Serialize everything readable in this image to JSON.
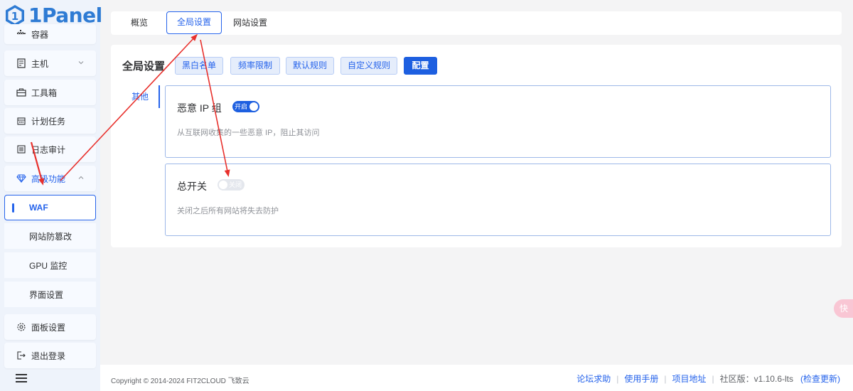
{
  "app": {
    "logo_text": "1Panel"
  },
  "sidebar": {
    "items": [
      {
        "label": "容器",
        "icon": "container-icon"
      },
      {
        "label": "主机",
        "icon": "host-icon"
      },
      {
        "label": "工具箱",
        "icon": "toolbox-icon"
      },
      {
        "label": "计划任务",
        "icon": "calendar-icon"
      },
      {
        "label": "日志审计",
        "icon": "log-icon"
      },
      {
        "label": "高级功能",
        "icon": "diamond-icon"
      }
    ],
    "subitems": [
      {
        "label": "WAF"
      },
      {
        "label": "网站防篡改"
      },
      {
        "label": "GPU 监控"
      },
      {
        "label": "界面设置"
      }
    ],
    "bottom_items": [
      {
        "label": "面板设置",
        "icon": "gear-icon"
      },
      {
        "label": "退出登录",
        "icon": "logout-icon"
      }
    ]
  },
  "tabs": [
    {
      "label": "概览"
    },
    {
      "label": "全局设置"
    },
    {
      "label": "网站设置"
    }
  ],
  "main": {
    "title": "全局设置",
    "buttons": [
      {
        "label": "黑白名单"
      },
      {
        "label": "频率限制"
      },
      {
        "label": "默认规则"
      },
      {
        "label": "自定义规则"
      },
      {
        "label": "配置"
      }
    ],
    "side_tab": "其他",
    "panels": [
      {
        "title": "恶意 IP 组",
        "switch_label": "开启",
        "switch_on": true,
        "desc": "从互联网收集的一些恶意 IP，阻止其访问"
      },
      {
        "title": "总开关",
        "switch_label": "关闭",
        "switch_on": false,
        "desc": "关闭之后所有网站将失去防护"
      }
    ]
  },
  "footer": {
    "copyright": "Copyright © 2014-2024 FIT2CLOUD 飞致云",
    "links": [
      "论坛求助",
      "使用手册",
      "项目地址"
    ],
    "version": "社区版：v1.10.6-lts",
    "check_update": "(检查更新)"
  },
  "float_button": {
    "label": "快"
  },
  "colors": {
    "primary": "#2563eb",
    "annotation": "#e8302c"
  }
}
